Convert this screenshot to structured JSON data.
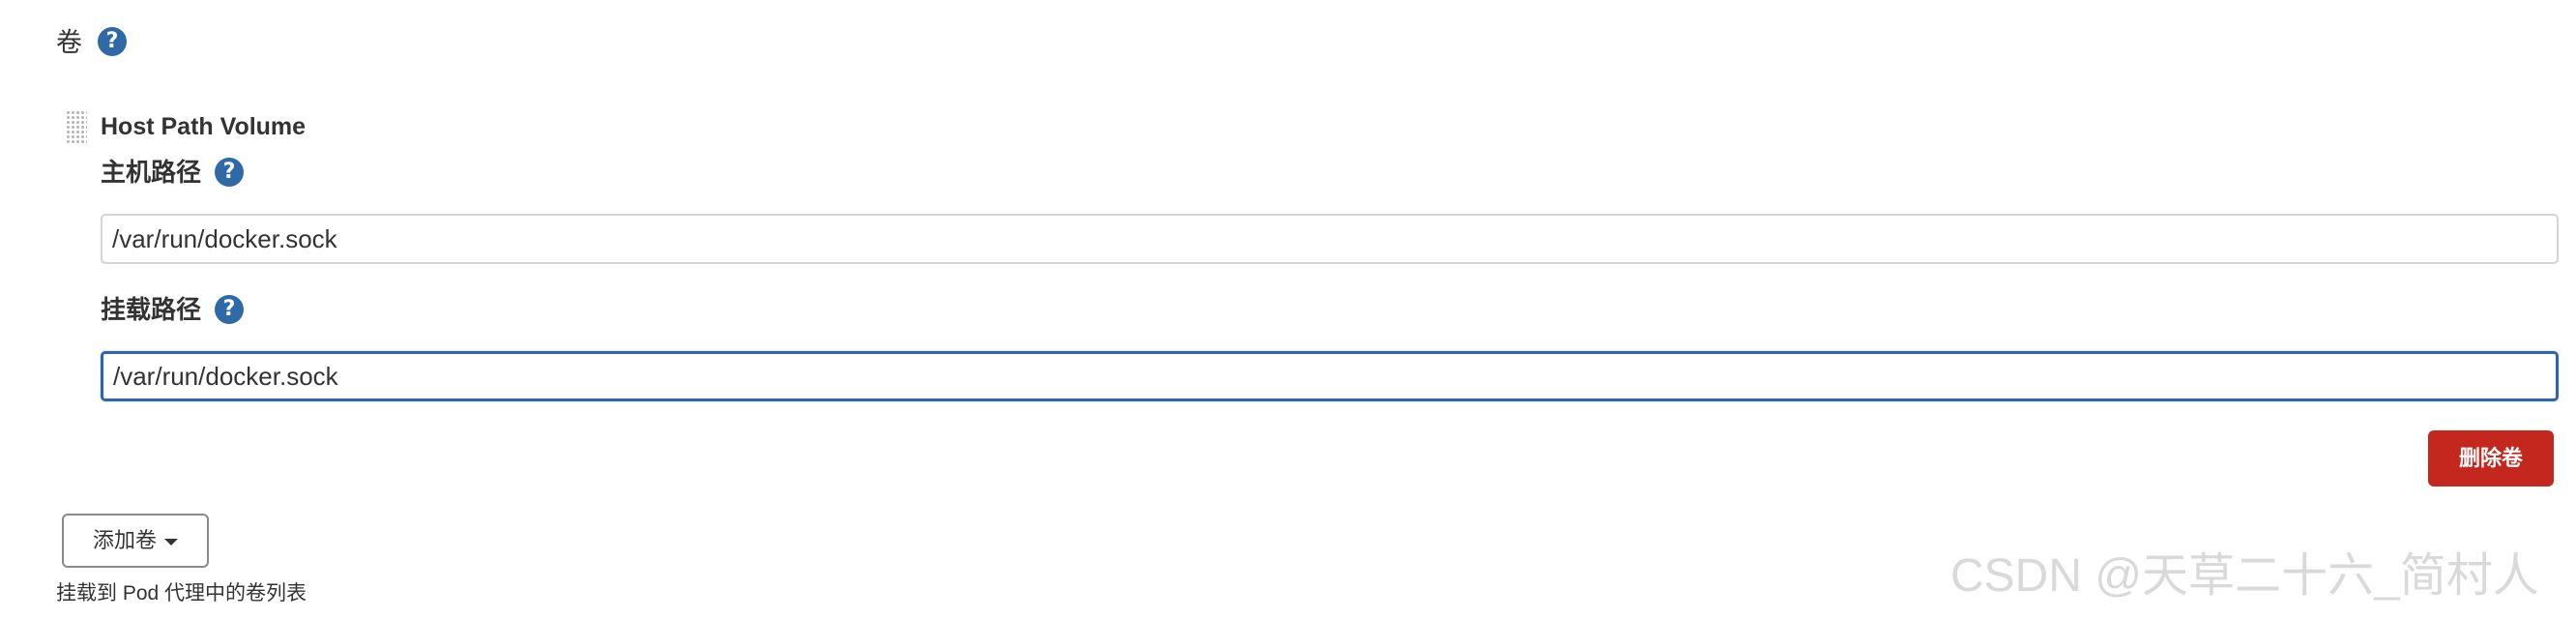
{
  "section": {
    "title": "卷",
    "help_icon": "question-circle-icon"
  },
  "volume": {
    "drag_icon": "drag-handle-icon",
    "title": "Host Path Volume",
    "host_path": {
      "label": "主机路径",
      "value": "/var/run/docker.sock",
      "help_icon": "question-circle-icon"
    },
    "mount_path": {
      "label": "挂载路径",
      "value": "/var/run/docker.sock",
      "help_icon": "question-circle-icon"
    },
    "delete_button": "删除卷"
  },
  "add_button": {
    "label": "添加卷",
    "icon": "caret-down-icon"
  },
  "description": "挂载到 Pod 代理中的卷列表",
  "watermark": "CSDN @天草二十六_简村人",
  "colors": {
    "help_icon": "#2f6aa6",
    "delete_button": "#c4271e",
    "focus_border": "#2f64ae"
  }
}
